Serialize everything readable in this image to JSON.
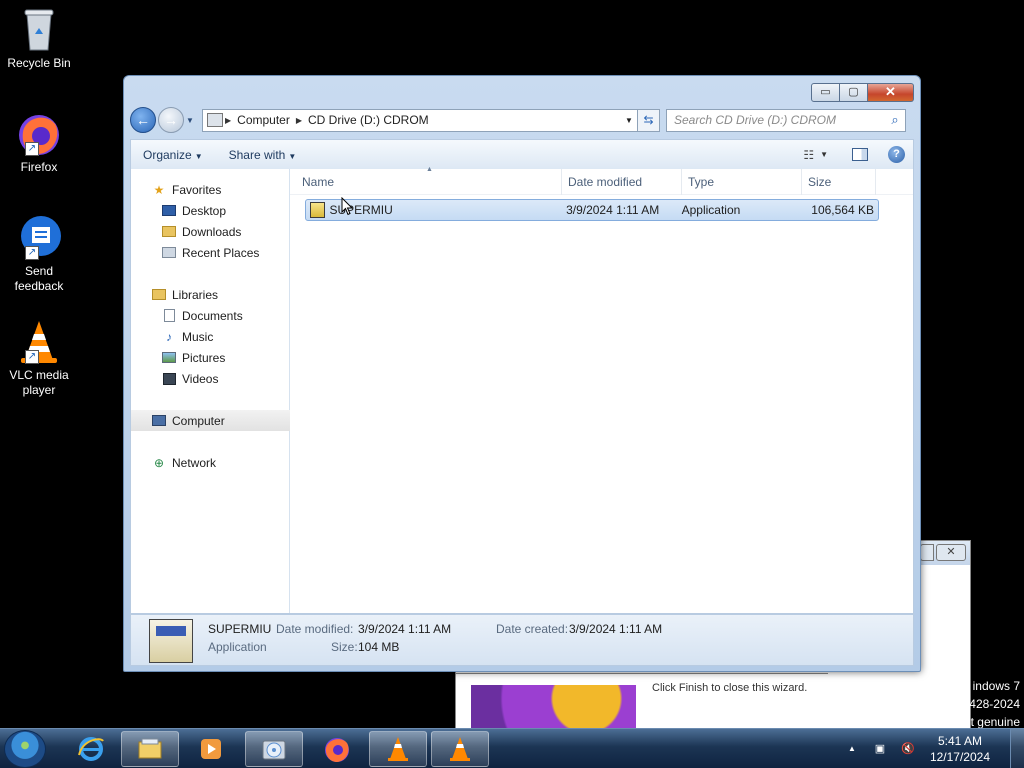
{
  "desktop": {
    "icons": [
      {
        "label": "Recycle Bin"
      },
      {
        "label": "Firefox"
      },
      {
        "label": "Send feedback"
      },
      {
        "label": "VLC media player"
      }
    ],
    "watermark": [
      "indows 7",
      "428-2024",
      "t genuine"
    ]
  },
  "background_window": {
    "text": "Click Finish to close this wizard."
  },
  "window": {
    "controls": {
      "minimize": "▭",
      "maximize": "▢",
      "close": "✕"
    },
    "address": {
      "segments": [
        "Computer",
        "CD Drive (D:) CDROM"
      ]
    },
    "search": {
      "placeholder": "Search CD Drive (D:) CDROM"
    },
    "toolbar": {
      "organize": "Organize",
      "share_with": "Share with"
    },
    "nav_pane": {
      "favorites": "Favorites",
      "desktop": "Desktop",
      "downloads": "Downloads",
      "recent_places": "Recent Places",
      "libraries": "Libraries",
      "documents": "Documents",
      "music": "Music",
      "pictures": "Pictures",
      "videos": "Videos",
      "computer": "Computer",
      "network": "Network"
    },
    "columns": {
      "name": "Name",
      "date_modified": "Date modified",
      "type": "Type",
      "size": "Size"
    },
    "files": [
      {
        "name": "SUPERMIU",
        "date_modified": "3/9/2024 1:11 AM",
        "type": "Application",
        "size": "106,564 KB"
      }
    ],
    "details": {
      "name": "SUPERMIU",
      "type": "Application",
      "date_modified_label": "Date modified:",
      "date_modified": "3/9/2024 1:11 AM",
      "date_created_label": "Date created:",
      "date_created": "3/9/2024 1:11 AM",
      "size_label": "Size:",
      "size": "104 MB"
    }
  },
  "taskbar": {
    "time": "5:41 AM",
    "date": "12/17/2024"
  },
  "colors": {
    "accent": "#2a66b7",
    "selection": "#c5dbf4",
    "desktop_bg": "#000000"
  }
}
